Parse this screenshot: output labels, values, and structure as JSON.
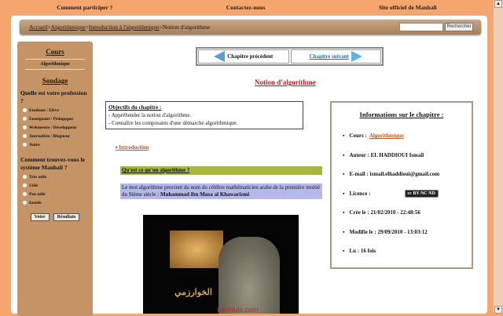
{
  "topnav": [
    "Comment participer ?",
    "Contactez-nous",
    "Site officiel de Manhali"
  ],
  "breadcrumb": {
    "items": [
      "Accueil",
      "Algorithmique",
      "Introduction à l'algorithmique"
    ],
    "current": "Notion d'algorithme",
    "sep": " > "
  },
  "search": {
    "value": "",
    "button": "Rechercher"
  },
  "sidebar": {
    "cours_title": "Cours",
    "cours_item": "Algorithmique",
    "sondage_title": "Sondage",
    "q1": "Quelle est votre profession ?",
    "q1_options": [
      "Etudiant / Elève",
      "Enseignant / Pédagogue",
      "Webmestre / Développeur",
      "Journaliste / Blogueur",
      "Autre"
    ],
    "q2": "Comment trouvez-vous le système Manhali ?",
    "q2_options": [
      "Très utile",
      "Utile",
      "Peu utile",
      "Inutile"
    ],
    "vote": "Voter",
    "results": "Résultats"
  },
  "chapnav": {
    "prev": "Chapitre précédent",
    "next": "Chapitre suivant"
  },
  "title": "Notion d'algorithme",
  "objectives": {
    "title": "Objectifs du chapitre :",
    "items": [
      "- Appréhender la notion d'algorithme.",
      "- Connaître les composants d'une démarche algorithmique."
    ]
  },
  "intro_link": "Introduction",
  "question": "Qu'est ce qu'un algorithme ?",
  "definition": "Le mot algorithme provient du nom du célèbre mathématicien arabe de la première moitié du 9ième siècle : ",
  "definition_name": "Muhammad ibn Musa al Khawarizmi",
  "video": {
    "arabic": "الخوارزمي",
    "brand": "InfoNuls.com"
  },
  "info": {
    "title": "Informations sur le chapitre :",
    "cours_label": "Cours :",
    "cours": "Algorithmique",
    "auteur": "Auteur : EL HADDIOUI Ismail",
    "email": "E-mail : ismail.elhaddioui@gmail.com",
    "licence": "Licence :",
    "licence_badge": "cc BY NC ND",
    "cree": "Crée le : 21/02/2010 - 22:48:56",
    "modifie": "Modifie le : 29/09/2010 - 13:03:12",
    "lu": "Lu : 16 fois"
  }
}
